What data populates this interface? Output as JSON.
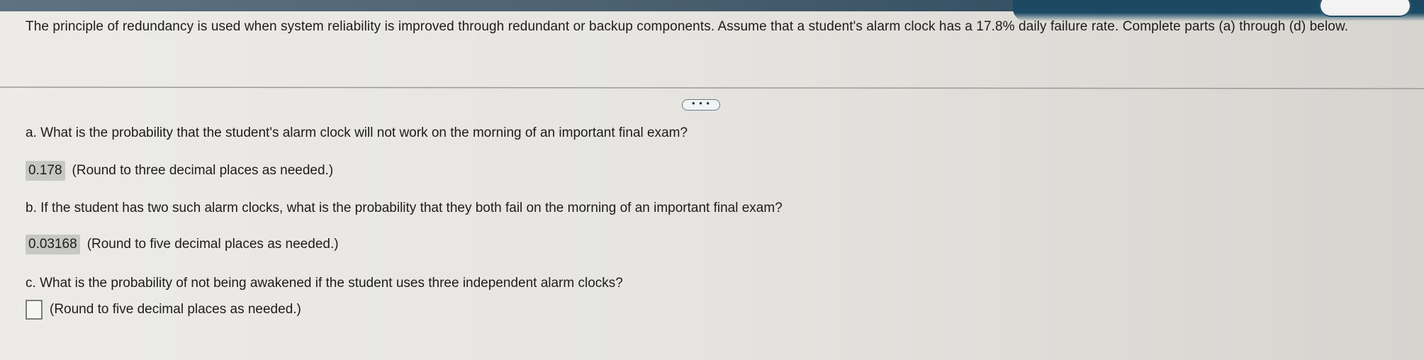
{
  "intro_text": "The principle of redundancy is used when system reliability is improved through redundant or backup components. Assume that a student's alarm clock has a 17.8% daily failure rate. Complete parts (a) through (d) below.",
  "more_button_label": "• • •",
  "questions": [
    {
      "prefix": "a.",
      "text": "What is the probability that the student's alarm clock will not work on the morning of an important final exam?",
      "answer": "0.178",
      "note": "(Round to three decimal places as needed.)"
    },
    {
      "prefix": "b.",
      "text": "If the student has two such alarm clocks, what is the probability that they both fail on the morning of an important final exam?",
      "answer": "0.03168",
      "note": "(Round to five decimal places as needed.)"
    },
    {
      "prefix": "c.",
      "text": "What is the probability of not being awakened if the student uses three independent alarm clocks?",
      "answer": "",
      "note": "(Round to five decimal places as needed.)"
    }
  ]
}
